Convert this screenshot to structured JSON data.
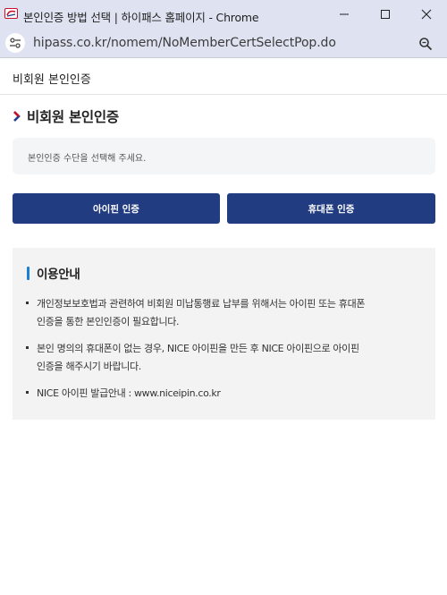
{
  "window": {
    "title": "본인인증 방법 선택 | 하이패스 홈페이지 - Chrome",
    "favicon": "hipass-favicon-icon"
  },
  "addressbar": {
    "url": "hipass.co.kr/nomem/NoMemberCertSelectPop.do",
    "site_info_icon": "tune-icon",
    "zoom_icon": "zoom-icon"
  },
  "header": {
    "title": "비회원 본인인증"
  },
  "main": {
    "section_title": "비회원 본인인증",
    "instruction": "본인인증 수단을 선택해 주세요.",
    "buttons": {
      "ipin": "아이핀 인증",
      "phone": "휴대폰 인증"
    },
    "notice": {
      "heading": "이용안내",
      "items": [
        [
          "개인정보보호법과 관련하여 비회원 미납통행료 납부를 위해서는 아이핀 또는 휴대폰",
          "인증을 통한 본인인증이 필요합니다."
        ],
        [
          "본인 명의의 휴대폰이 없는 경우, NICE 아이핀을 만든 후 NICE 아이핀으로 아이핀",
          "인증을 해주시기 바랍니다."
        ],
        [
          "NICE 아이핀 발급안내 : www.niceipin.co.kr"
        ]
      ]
    }
  },
  "colors": {
    "button": "#223c82",
    "accent_chevron": "#c8102e",
    "notice_bar": "#1b7fd6",
    "chrome_frame": "#dfe3f1"
  }
}
